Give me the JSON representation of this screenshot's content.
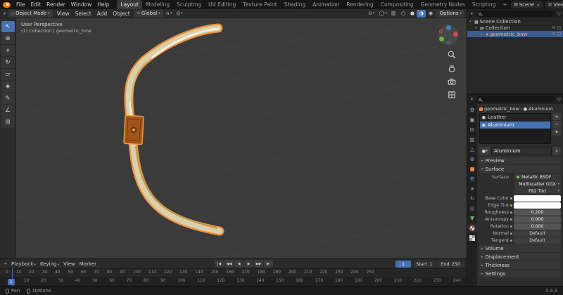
{
  "topbar": {
    "menus": [
      "File",
      "Edit",
      "Render",
      "Window",
      "Help"
    ],
    "workspace_tabs": [
      {
        "label": "Layout",
        "active": true
      },
      {
        "label": "Modeling"
      },
      {
        "label": "Sculpting"
      },
      {
        "label": "UV Editing"
      },
      {
        "label": "Texture Paint"
      },
      {
        "label": "Shading"
      },
      {
        "label": "Animation"
      },
      {
        "label": "Rendering"
      },
      {
        "label": "Compositing"
      },
      {
        "label": "Geometry Nodes"
      },
      {
        "label": "Scripting"
      }
    ],
    "new_tab_label": "+",
    "scene_name": "Scene",
    "view_layer_name": "ViewLayer"
  },
  "viewport_header": {
    "mode": "Object Mode",
    "menus": [
      "View",
      "Select",
      "Add",
      "Object"
    ],
    "orientation": "Global",
    "options_label": "Options",
    "shading_modes": [
      {
        "icon": "wireframe-shading-icon"
      },
      {
        "icon": "solid-shading-icon"
      },
      {
        "icon": "material-preview-shading-icon",
        "active": true
      },
      {
        "icon": "rendered-shading-icon"
      }
    ]
  },
  "tool_shelf": [
    {
      "icon": "select-box-tool-icon",
      "glyph": "↖",
      "active": true
    },
    {
      "icon": "cursor-tool-icon",
      "glyph": "⊕"
    },
    {
      "icon": "move-tool-icon",
      "glyph": "+"
    },
    {
      "icon": "rotate-tool-icon",
      "glyph": "↻"
    },
    {
      "icon": "scale-tool-icon",
      "glyph": "▱"
    },
    {
      "icon": "transform-tool-icon",
      "glyph": "◈"
    },
    {
      "icon": "annotate-tool-icon",
      "glyph": "✎"
    },
    {
      "icon": "measure-tool-icon",
      "glyph": "∠"
    },
    {
      "icon": "add-cube-tool-icon",
      "glyph": "⊞"
    }
  ],
  "viewport": {
    "perspective_label": "User Perspective",
    "context_label": "(1) Collection | geometric_bow"
  },
  "outliner": {
    "rows": [
      {
        "label": "Scene Collection",
        "depth": 0,
        "icon": "scene-collection-icon",
        "chevron": "▾"
      },
      {
        "label": "Collection",
        "depth": 1,
        "icon": "collection-icon",
        "chevron": "▾"
      },
      {
        "label": "geometric_bow",
        "depth": 2,
        "icon": "mesh-object-icon",
        "chevron": "▸",
        "selected": true
      }
    ]
  },
  "properties": {
    "breadcrumb_object": "geometric_bow",
    "breadcrumb_material": "Aluminium",
    "tabs": [
      {
        "icon": "tool-icon"
      },
      {
        "icon": "render-icon"
      },
      {
        "icon": "output-icon"
      },
      {
        "icon": "view-layer-icon"
      },
      {
        "icon": "scene-icon"
      },
      {
        "icon": "world-icon"
      },
      {
        "icon": "object-icon"
      },
      {
        "icon": "modifiers-icon"
      },
      {
        "icon": "particles-icon"
      },
      {
        "icon": "physics-icon"
      },
      {
        "icon": "constraints-icon"
      },
      {
        "icon": "object-data-icon"
      },
      {
        "icon": "material-icon",
        "active": true
      },
      {
        "icon": "texture-icon"
      }
    ],
    "material_slots": [
      {
        "label": "Leather",
        "icon": "material-slot-icon"
      },
      {
        "label": "Aluminium",
        "icon": "material-slot-icon",
        "selected": true
      }
    ],
    "slot_add_label": "+",
    "slot_remove_label": "−",
    "slot_specials_glyph": "▾",
    "material_name": "Aluminium",
    "panels": {
      "preview": "Preview",
      "surface": "Surface",
      "volume": "Volume",
      "displacement": "Displacement",
      "thickness": "Thickness",
      "settings": "Settings"
    },
    "surface_rows": [
      {
        "label": "Surface",
        "value": "Metallic BSDF",
        "type": "shader"
      },
      {
        "label": "",
        "value": "Multiscatter GGX",
        "type": "menu"
      },
      {
        "label": "",
        "value": "F82 Tint",
        "type": "menu"
      },
      {
        "label": "Base Color",
        "value": "",
        "type": "color"
      },
      {
        "label": "Edge Tint",
        "value": "",
        "type": "color"
      },
      {
        "label": "Roughness",
        "value": "0.200",
        "type": "number"
      },
      {
        "label": "Anisotropy",
        "value": "0.000",
        "type": "number"
      },
      {
        "label": "Rotation",
        "value": "0.000",
        "type": "number"
      },
      {
        "label": "Normal",
        "value": "Default",
        "type": "vector"
      },
      {
        "label": "Tangent",
        "value": "Default",
        "type": "vector"
      }
    ],
    "swatch_color": "#ffffff"
  },
  "timeline": {
    "menus": [
      {
        "label": "Playback",
        "chevron": true
      },
      {
        "label": "Keying",
        "chevron": true
      },
      {
        "label": "View"
      },
      {
        "label": "Marker"
      }
    ],
    "buttons": [
      {
        "icon": "jump-to-start-icon",
        "glyph": "|◀"
      },
      {
        "icon": "previous-keyframe-icon",
        "glyph": "◀◀"
      },
      {
        "icon": "play-reverse-icon",
        "glyph": "◀"
      },
      {
        "icon": "play-icon",
        "glyph": "▶"
      },
      {
        "icon": "next-keyframe-icon",
        "glyph": "▶▶"
      },
      {
        "icon": "jump-to-end-icon",
        "glyph": "▶|"
      }
    ],
    "current_frame": "1",
    "start_label": "Start",
    "start_value": "1",
    "end_label": "End",
    "end_value": "250",
    "ruler_top": [
      "0",
      "10",
      "20",
      "30",
      "40",
      "50",
      "60",
      "70",
      "80",
      "90",
      "100",
      "110",
      "120",
      "130",
      "140",
      "150",
      "160",
      "170",
      "180",
      "190",
      "200",
      "210",
      "220",
      "230",
      "240",
      "250"
    ],
    "ruler_bottom": [
      "10",
      "20",
      "30",
      "40",
      "50",
      "60",
      "70",
      "80",
      "90",
      "100",
      "110",
      "120",
      "130",
      "140",
      "150",
      "160",
      "170",
      "180",
      "190",
      "200",
      "210",
      "220",
      "230",
      "240"
    ]
  },
  "statusbar": {
    "hints": [
      {
        "label": "Pan"
      },
      {
        "label": "Options"
      }
    ],
    "version": "4.4.3"
  },
  "colors": {
    "accent_blue": "#4772b3",
    "selection_orange": "#f09a46",
    "object_orange": "#e8863c",
    "viewport_bg": "#3b3b3b"
  }
}
